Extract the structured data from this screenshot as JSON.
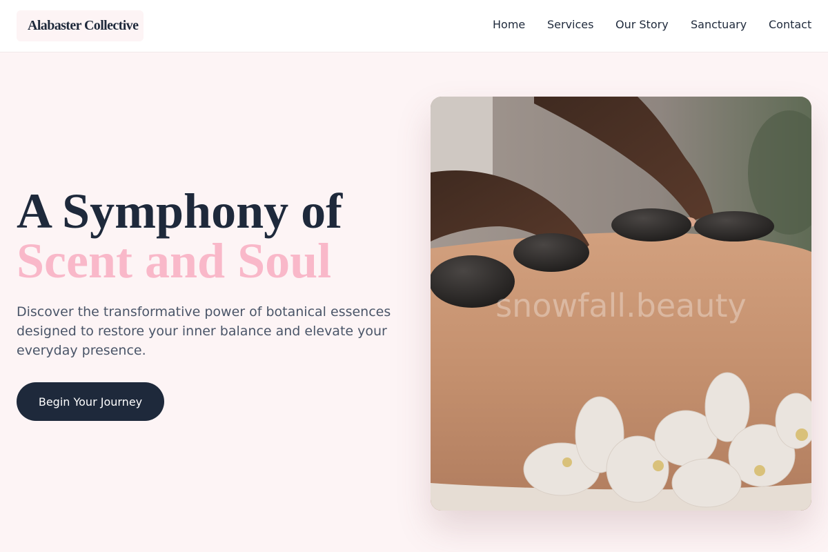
{
  "brand": {
    "name": "Alabaster Collective"
  },
  "nav": {
    "items": [
      {
        "label": "Home"
      },
      {
        "label": "Services"
      },
      {
        "label": "Our Story"
      },
      {
        "label": "Sanctuary"
      },
      {
        "label": "Contact"
      }
    ]
  },
  "hero": {
    "headline_line1": "A Symphony of",
    "headline_line2": "Scent and Soul",
    "subtitle": "Discover the transformative power of botanical essences designed to restore your inner balance and elevate your everyday presence.",
    "cta_label": "Begin Your Journey",
    "image_watermark": "snowfall.beauty"
  },
  "colors": {
    "page_bg": "#fdf4f5",
    "header_bg": "#ffffff",
    "primary_dark": "#1e293b",
    "accent_pink": "#f9b8c9",
    "body_text": "#4a5568"
  }
}
